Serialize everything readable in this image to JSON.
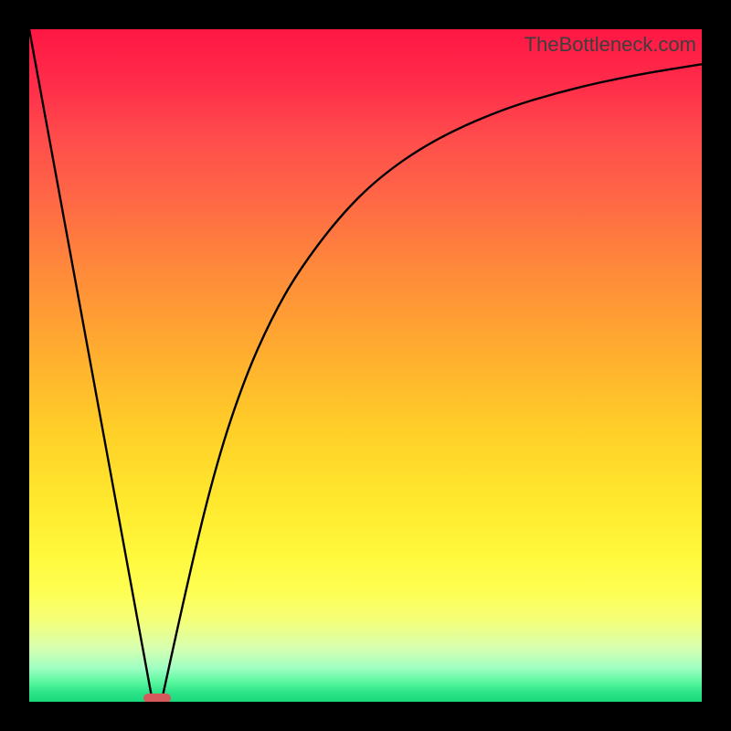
{
  "watermark": "TheBottleneck.com",
  "chart_data": {
    "type": "line",
    "title": "",
    "xlabel": "",
    "ylabel": "",
    "xlim": [
      0,
      100
    ],
    "ylim": [
      0,
      100
    ],
    "grid": false,
    "series": [
      {
        "name": "left-line",
        "x": [
          0,
          18.3
        ],
        "y": [
          100,
          0.2
        ]
      },
      {
        "name": "right-curve",
        "x": [
          19.7,
          24,
          28,
          32,
          36,
          40,
          46,
          52,
          60,
          70,
          80,
          90,
          100
        ],
        "y": [
          0.2,
          20,
          36,
          48,
          57,
          64,
          72,
          78,
          83.5,
          88,
          91,
          93.2,
          94.8
        ]
      }
    ],
    "marker": {
      "name": "optimum-marker",
      "x_center": 19,
      "y": 0.5,
      "width_pct": 4.0,
      "color": "#d45a5c"
    },
    "gradient_colors": {
      "top": "#ff1744",
      "mid_upper": "#ff8a3a",
      "mid": "#ffe82e",
      "mid_lower": "#feff55",
      "bottom": "#18d97c"
    }
  }
}
